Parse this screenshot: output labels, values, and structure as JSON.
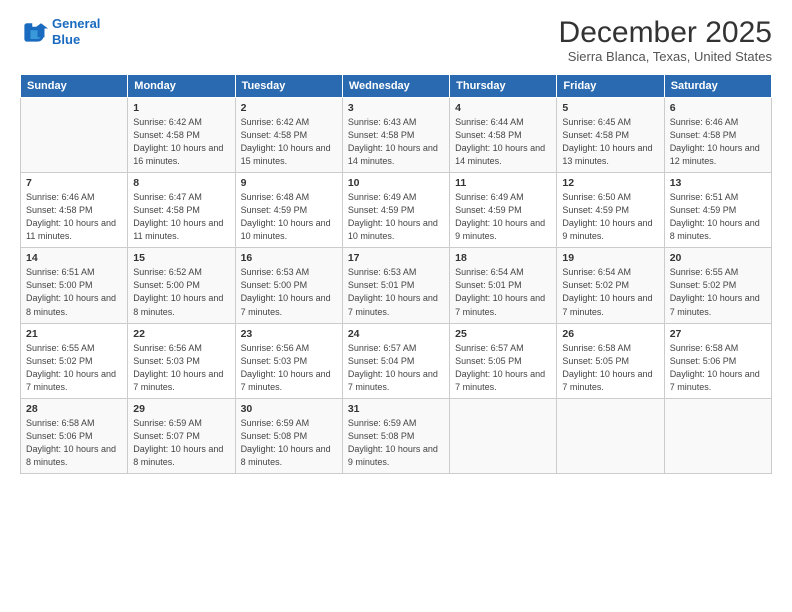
{
  "logo": {
    "line1": "General",
    "line2": "Blue"
  },
  "header": {
    "month": "December 2025",
    "location": "Sierra Blanca, Texas, United States"
  },
  "days_of_week": [
    "Sunday",
    "Monday",
    "Tuesday",
    "Wednesday",
    "Thursday",
    "Friday",
    "Saturday"
  ],
  "weeks": [
    [
      {
        "num": "",
        "sunrise": "",
        "sunset": "",
        "daylight": ""
      },
      {
        "num": "1",
        "sunrise": "Sunrise: 6:42 AM",
        "sunset": "Sunset: 4:58 PM",
        "daylight": "Daylight: 10 hours and 16 minutes."
      },
      {
        "num": "2",
        "sunrise": "Sunrise: 6:42 AM",
        "sunset": "Sunset: 4:58 PM",
        "daylight": "Daylight: 10 hours and 15 minutes."
      },
      {
        "num": "3",
        "sunrise": "Sunrise: 6:43 AM",
        "sunset": "Sunset: 4:58 PM",
        "daylight": "Daylight: 10 hours and 14 minutes."
      },
      {
        "num": "4",
        "sunrise": "Sunrise: 6:44 AM",
        "sunset": "Sunset: 4:58 PM",
        "daylight": "Daylight: 10 hours and 14 minutes."
      },
      {
        "num": "5",
        "sunrise": "Sunrise: 6:45 AM",
        "sunset": "Sunset: 4:58 PM",
        "daylight": "Daylight: 10 hours and 13 minutes."
      },
      {
        "num": "6",
        "sunrise": "Sunrise: 6:46 AM",
        "sunset": "Sunset: 4:58 PM",
        "daylight": "Daylight: 10 hours and 12 minutes."
      }
    ],
    [
      {
        "num": "7",
        "sunrise": "Sunrise: 6:46 AM",
        "sunset": "Sunset: 4:58 PM",
        "daylight": "Daylight: 10 hours and 11 minutes."
      },
      {
        "num": "8",
        "sunrise": "Sunrise: 6:47 AM",
        "sunset": "Sunset: 4:58 PM",
        "daylight": "Daylight: 10 hours and 11 minutes."
      },
      {
        "num": "9",
        "sunrise": "Sunrise: 6:48 AM",
        "sunset": "Sunset: 4:59 PM",
        "daylight": "Daylight: 10 hours and 10 minutes."
      },
      {
        "num": "10",
        "sunrise": "Sunrise: 6:49 AM",
        "sunset": "Sunset: 4:59 PM",
        "daylight": "Daylight: 10 hours and 10 minutes."
      },
      {
        "num": "11",
        "sunrise": "Sunrise: 6:49 AM",
        "sunset": "Sunset: 4:59 PM",
        "daylight": "Daylight: 10 hours and 9 minutes."
      },
      {
        "num": "12",
        "sunrise": "Sunrise: 6:50 AM",
        "sunset": "Sunset: 4:59 PM",
        "daylight": "Daylight: 10 hours and 9 minutes."
      },
      {
        "num": "13",
        "sunrise": "Sunrise: 6:51 AM",
        "sunset": "Sunset: 4:59 PM",
        "daylight": "Daylight: 10 hours and 8 minutes."
      }
    ],
    [
      {
        "num": "14",
        "sunrise": "Sunrise: 6:51 AM",
        "sunset": "Sunset: 5:00 PM",
        "daylight": "Daylight: 10 hours and 8 minutes."
      },
      {
        "num": "15",
        "sunrise": "Sunrise: 6:52 AM",
        "sunset": "Sunset: 5:00 PM",
        "daylight": "Daylight: 10 hours and 8 minutes."
      },
      {
        "num": "16",
        "sunrise": "Sunrise: 6:53 AM",
        "sunset": "Sunset: 5:00 PM",
        "daylight": "Daylight: 10 hours and 7 minutes."
      },
      {
        "num": "17",
        "sunrise": "Sunrise: 6:53 AM",
        "sunset": "Sunset: 5:01 PM",
        "daylight": "Daylight: 10 hours and 7 minutes."
      },
      {
        "num": "18",
        "sunrise": "Sunrise: 6:54 AM",
        "sunset": "Sunset: 5:01 PM",
        "daylight": "Daylight: 10 hours and 7 minutes."
      },
      {
        "num": "19",
        "sunrise": "Sunrise: 6:54 AM",
        "sunset": "Sunset: 5:02 PM",
        "daylight": "Daylight: 10 hours and 7 minutes."
      },
      {
        "num": "20",
        "sunrise": "Sunrise: 6:55 AM",
        "sunset": "Sunset: 5:02 PM",
        "daylight": "Daylight: 10 hours and 7 minutes."
      }
    ],
    [
      {
        "num": "21",
        "sunrise": "Sunrise: 6:55 AM",
        "sunset": "Sunset: 5:02 PM",
        "daylight": "Daylight: 10 hours and 7 minutes."
      },
      {
        "num": "22",
        "sunrise": "Sunrise: 6:56 AM",
        "sunset": "Sunset: 5:03 PM",
        "daylight": "Daylight: 10 hours and 7 minutes."
      },
      {
        "num": "23",
        "sunrise": "Sunrise: 6:56 AM",
        "sunset": "Sunset: 5:03 PM",
        "daylight": "Daylight: 10 hours and 7 minutes."
      },
      {
        "num": "24",
        "sunrise": "Sunrise: 6:57 AM",
        "sunset": "Sunset: 5:04 PM",
        "daylight": "Daylight: 10 hours and 7 minutes."
      },
      {
        "num": "25",
        "sunrise": "Sunrise: 6:57 AM",
        "sunset": "Sunset: 5:05 PM",
        "daylight": "Daylight: 10 hours and 7 minutes."
      },
      {
        "num": "26",
        "sunrise": "Sunrise: 6:58 AM",
        "sunset": "Sunset: 5:05 PM",
        "daylight": "Daylight: 10 hours and 7 minutes."
      },
      {
        "num": "27",
        "sunrise": "Sunrise: 6:58 AM",
        "sunset": "Sunset: 5:06 PM",
        "daylight": "Daylight: 10 hours and 7 minutes."
      }
    ],
    [
      {
        "num": "28",
        "sunrise": "Sunrise: 6:58 AM",
        "sunset": "Sunset: 5:06 PM",
        "daylight": "Daylight: 10 hours and 8 minutes."
      },
      {
        "num": "29",
        "sunrise": "Sunrise: 6:59 AM",
        "sunset": "Sunset: 5:07 PM",
        "daylight": "Daylight: 10 hours and 8 minutes."
      },
      {
        "num": "30",
        "sunrise": "Sunrise: 6:59 AM",
        "sunset": "Sunset: 5:08 PM",
        "daylight": "Daylight: 10 hours and 8 minutes."
      },
      {
        "num": "31",
        "sunrise": "Sunrise: 6:59 AM",
        "sunset": "Sunset: 5:08 PM",
        "daylight": "Daylight: 10 hours and 9 minutes."
      },
      {
        "num": "",
        "sunrise": "",
        "sunset": "",
        "daylight": ""
      },
      {
        "num": "",
        "sunrise": "",
        "sunset": "",
        "daylight": ""
      },
      {
        "num": "",
        "sunrise": "",
        "sunset": "",
        "daylight": ""
      }
    ]
  ]
}
